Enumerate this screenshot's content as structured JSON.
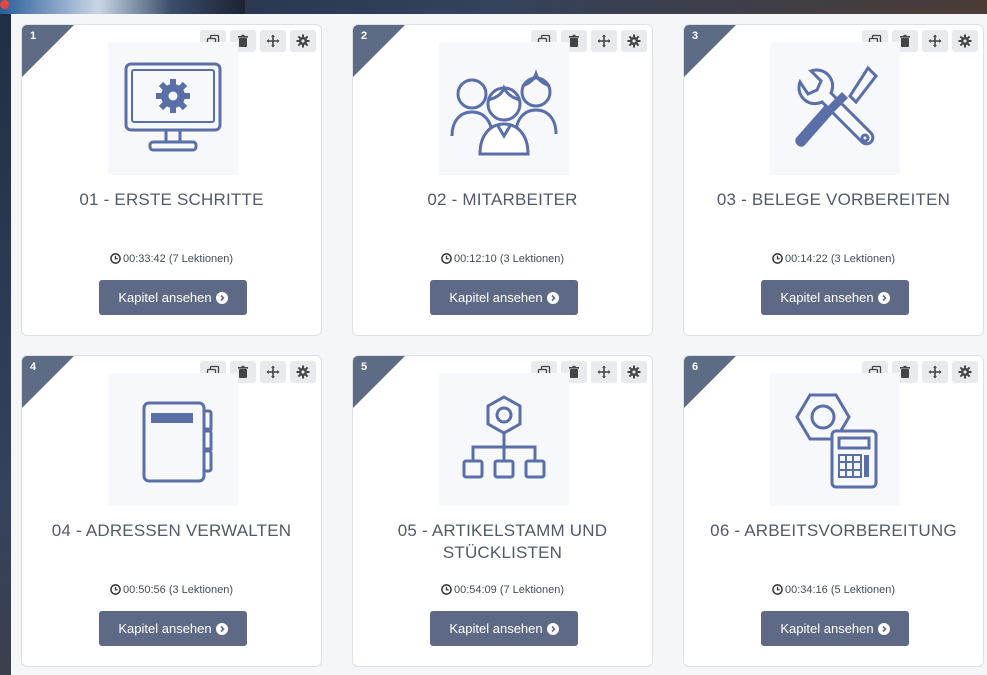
{
  "cards": [
    {
      "number": "1",
      "title": "01 - ERSTE SCHRITTE",
      "duration": "00:33:42 (7 Lektionen)",
      "button": "Kapitel ansehen",
      "icon": "monitor-gear-icon"
    },
    {
      "number": "2",
      "title": "02 - MITARBEITER",
      "duration": "00:12:10 (3 Lektionen)",
      "button": "Kapitel ansehen",
      "icon": "team-icon"
    },
    {
      "number": "3",
      "title": "03 - BELEGE VORBEREITEN",
      "duration": "00:14:22 (3 Lektionen)",
      "button": "Kapitel ansehen",
      "icon": "tools-icon"
    },
    {
      "number": "4",
      "title": "04 - ADRESSEN VERWALTEN",
      "duration": "00:50:56 (3 Lektionen)",
      "button": "Kapitel ansehen",
      "icon": "address-book-icon"
    },
    {
      "number": "5",
      "title": "05 - ARTIKELSTAMM UND STÜCKLISTEN",
      "duration": "00:54:09 (7 Lektionen)",
      "button": "Kapitel ansehen",
      "icon": "hierarchy-icon"
    },
    {
      "number": "6",
      "title": "06 - ARBEITSVORBEREITUNG",
      "duration": "00:34:16 (5 Lektionen)",
      "button": "Kapitel ansehen",
      "icon": "nut-calculator-icon"
    }
  ],
  "card_tools": [
    "copy-icon",
    "delete-icon",
    "move-icon",
    "settings-icon"
  ],
  "colors": {
    "accent": "#5e6a85",
    "icon": "#5a6fa8",
    "title": "#505a68"
  }
}
